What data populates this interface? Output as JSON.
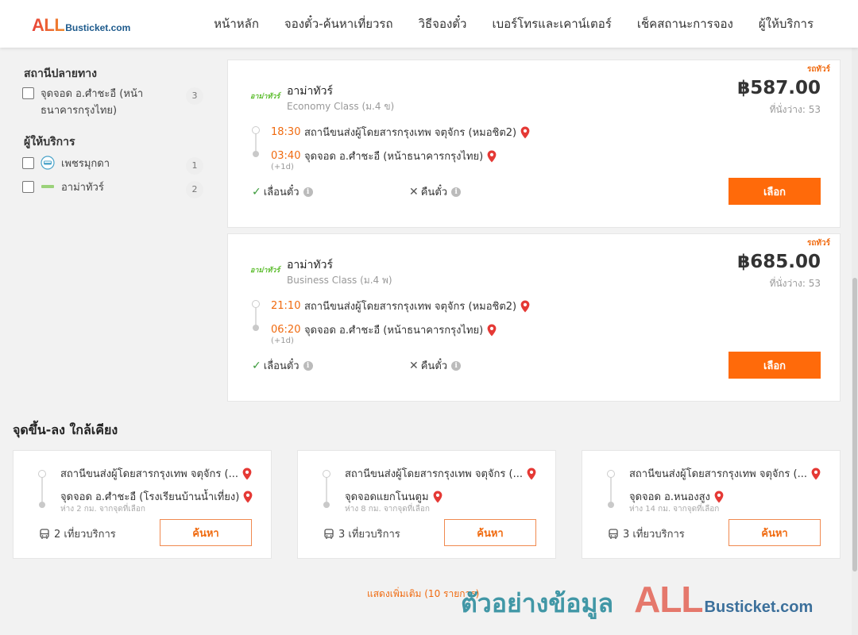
{
  "header": {
    "logo_all": "ALL",
    "logo_rest": "Busticket.com",
    "nav": [
      "หน้าหลัก",
      "จองตั๋ว-ค้นหาเที่ยวรถ",
      "วิธีจองตั๋ว",
      "เบอร์โทรและเคาน์เตอร์",
      "เช็คสถานะการจอง",
      "ผู้ให้บริการ"
    ]
  },
  "sidebar": {
    "destination_heading": "สถานีปลายทาง",
    "destination_items": [
      {
        "label": "จุดจอด อ.ศำชะอื (หน้าธนาคารกรุงไทย)",
        "count": "3"
      }
    ],
    "operator_heading": "ผู้ให้บริการ",
    "operator_items": [
      {
        "label": "เพชรมุกดา",
        "count": "1"
      },
      {
        "label": "อาม่าทัวร์",
        "count": "2"
      }
    ]
  },
  "trips": [
    {
      "tag": "รถทัวร์",
      "logo": "อาม่าทัวร์",
      "operator": "อาม่าทัวร์",
      "class": "Economy Class (ม.4 ข)",
      "price": "฿587.00",
      "seats": "ที่นั่งว่าง: 53",
      "depart_time": "18:30",
      "depart_place": "สถานีขนส่งผู้โดยสารกรุงเทพ จตุจักร (หมอชิต2)",
      "arrive_time": "03:40",
      "arrive_place": "จุดจอด อ.ศำชะอื (หน้าธนาคารกรุงไทย)",
      "next_day": "(+1d)",
      "change_label": "เลื่อนตั๋ว",
      "refund_label": "คืนตั๋ว",
      "select_label": "เลือก"
    },
    {
      "tag": "รถทัวร์",
      "logo": "อาม่าทัวร์",
      "operator": "อาม่าทัวร์",
      "class": "Business Class (ม.4 พ)",
      "price": "฿685.00",
      "seats": "ที่นั่งว่าง: 53",
      "depart_time": "21:10",
      "depart_place": "สถานีขนส่งผู้โดยสารกรุงเทพ จตุจักร (หมอชิต2)",
      "arrive_time": "06:20",
      "arrive_place": "จุดจอด อ.ศำชะอื (หน้าธนาคารกรุงไทย)",
      "next_day": "(+1d)",
      "change_label": "เลื่อนตั๋ว",
      "refund_label": "คืนตั๋ว",
      "select_label": "เลือก"
    }
  ],
  "nearby": {
    "title": "จุดขึ้น-ลง ใกล้เคียง",
    "cards": [
      {
        "from": "สถานีขนส่งผู้โดยสารกรุงเทพ จตุจักร (...",
        "to": "จุดจอด อ.ศำชะอื (โรงเรียนบ้านน้ำเที่ยง)",
        "distance": "ห่าง 2 กม. จากจุดที่เลือก",
        "trips": "2 เที่ยวบริการ",
        "button": "ค้นหา"
      },
      {
        "from": "สถานีขนส่งผู้โดยสารกรุงเทพ จตุจักร (...",
        "to": "จุดจอดแยกโนนตูม",
        "distance": "ห่าง 8 กม. จากจุดที่เลือก",
        "trips": "3 เที่ยวบริการ",
        "button": "ค้นหา"
      },
      {
        "from": "สถานีขนส่งผู้โดยสารกรุงเทพ จตุจักร (...",
        "to": "จุดจอด อ.หนองสูง",
        "distance": "ห่าง 14 กม. จากจุดที่เลือก",
        "trips": "3 เที่ยวบริการ",
        "button": "ค้นหา"
      }
    ],
    "show_more": "แสดงเพิ่มเติม (10 รายการ)"
  },
  "watermark": {
    "text": "ตัวอย่างข้อมูล",
    "all": "ALL",
    "rest": "Busticket.com"
  },
  "icons": {
    "pin": "map-pin-icon",
    "check": "check-icon",
    "cross": "cross-icon",
    "info": "info-icon",
    "bus": "bus-icon"
  },
  "colors": {
    "accent": "#ff6a0a",
    "time": "#f06a0f",
    "pin": "#e53935",
    "check": "#3a9a3a",
    "brand_blue": "#1d5a8c"
  }
}
